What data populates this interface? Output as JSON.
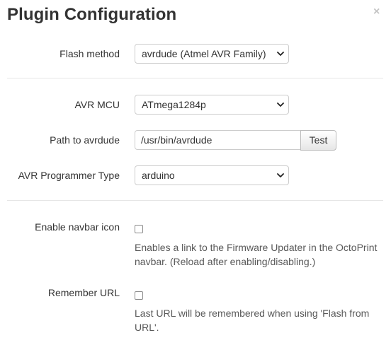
{
  "dialog": {
    "title": "Plugin Configuration",
    "close_label": "×"
  },
  "flash_method": {
    "label": "Flash method",
    "selected": "avrdude (Atmel AVR Family)"
  },
  "avr_mcu": {
    "label": "AVR MCU",
    "selected": "ATmega1284p"
  },
  "avrdude_path": {
    "label": "Path to avrdude",
    "value": "/usr/bin/avrdude",
    "test_button": "Test"
  },
  "programmer_type": {
    "label": "AVR Programmer Type",
    "selected": "arduino"
  },
  "navbar_icon": {
    "label": "Enable navbar icon",
    "checked": false,
    "help": "Enables a link to the Firmware Updater in the OctoPrint navbar. (Reload after enabling/disabling.)"
  },
  "remember_url": {
    "label": "Remember URL",
    "checked": false,
    "help": "Last URL will be remembered when using 'Flash from URL'."
  }
}
